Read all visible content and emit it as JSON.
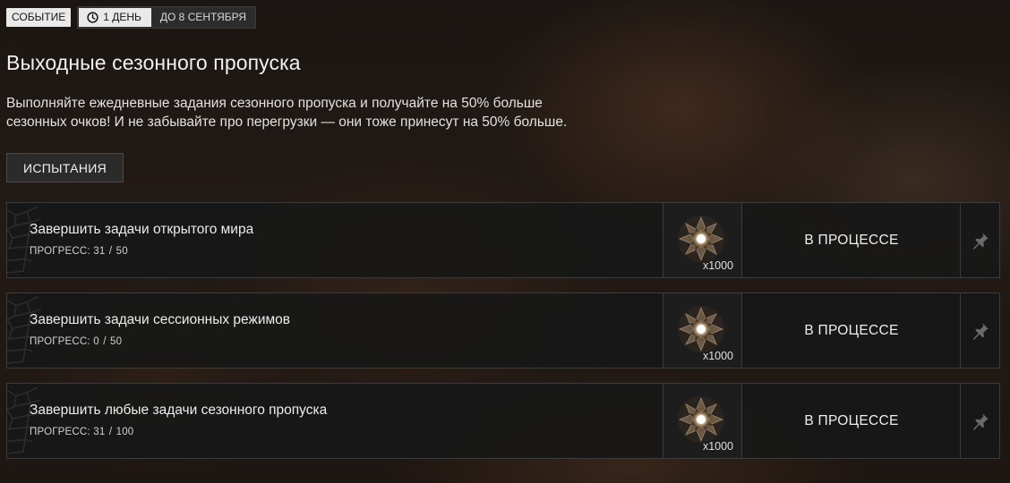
{
  "header": {
    "event_tag": "СОБЫТИЕ",
    "days_left": "1 ДЕНЬ",
    "until": "ДО 8 СЕНТЯБРЯ",
    "clock_icon": "clock-icon"
  },
  "title": "Выходные сезонного пропуска",
  "description": {
    "line1": "Выполняйте ежедневные задания сезонного пропуска и получайте на 50% больше",
    "line2": "сезонных очков! И не забывайте про перегрузки — они тоже принесут на 50% больше."
  },
  "challenges_button": "ИСПЫТАНИЯ",
  "tasks": [
    {
      "title": "Завершить задачи открытого мира",
      "progress_label": "ПРОГРЕСС:",
      "progress_current": "31",
      "progress_total": "50",
      "progress_fraction": 0.62,
      "reward_qty": "x1000",
      "reward_icon": "season-points-icon",
      "status": "В ПРОЦЕССЕ",
      "pin_icon": "pin-icon"
    },
    {
      "title": "Завершить задачи сессионных режимов",
      "progress_label": "ПРОГРЕСС:",
      "progress_current": "0",
      "progress_total": "50",
      "progress_fraction": 0,
      "reward_qty": "x1000",
      "reward_icon": "season-points-icon",
      "status": "В ПРОЦЕССЕ",
      "pin_icon": "pin-icon"
    },
    {
      "title": "Завершить любые задачи сезонного пропуска",
      "progress_label": "ПРОГРЕСС:",
      "progress_current": "31",
      "progress_total": "100",
      "progress_fraction": 0.31,
      "reward_qty": "x1000",
      "reward_icon": "season-points-icon",
      "status": "В ПРОЦЕССЕ",
      "pin_icon": "pin-icon"
    }
  ],
  "colors": {
    "tag_bg": "#e9e9e9",
    "panel_bg": "#181818",
    "text": "#e6e6e6"
  }
}
